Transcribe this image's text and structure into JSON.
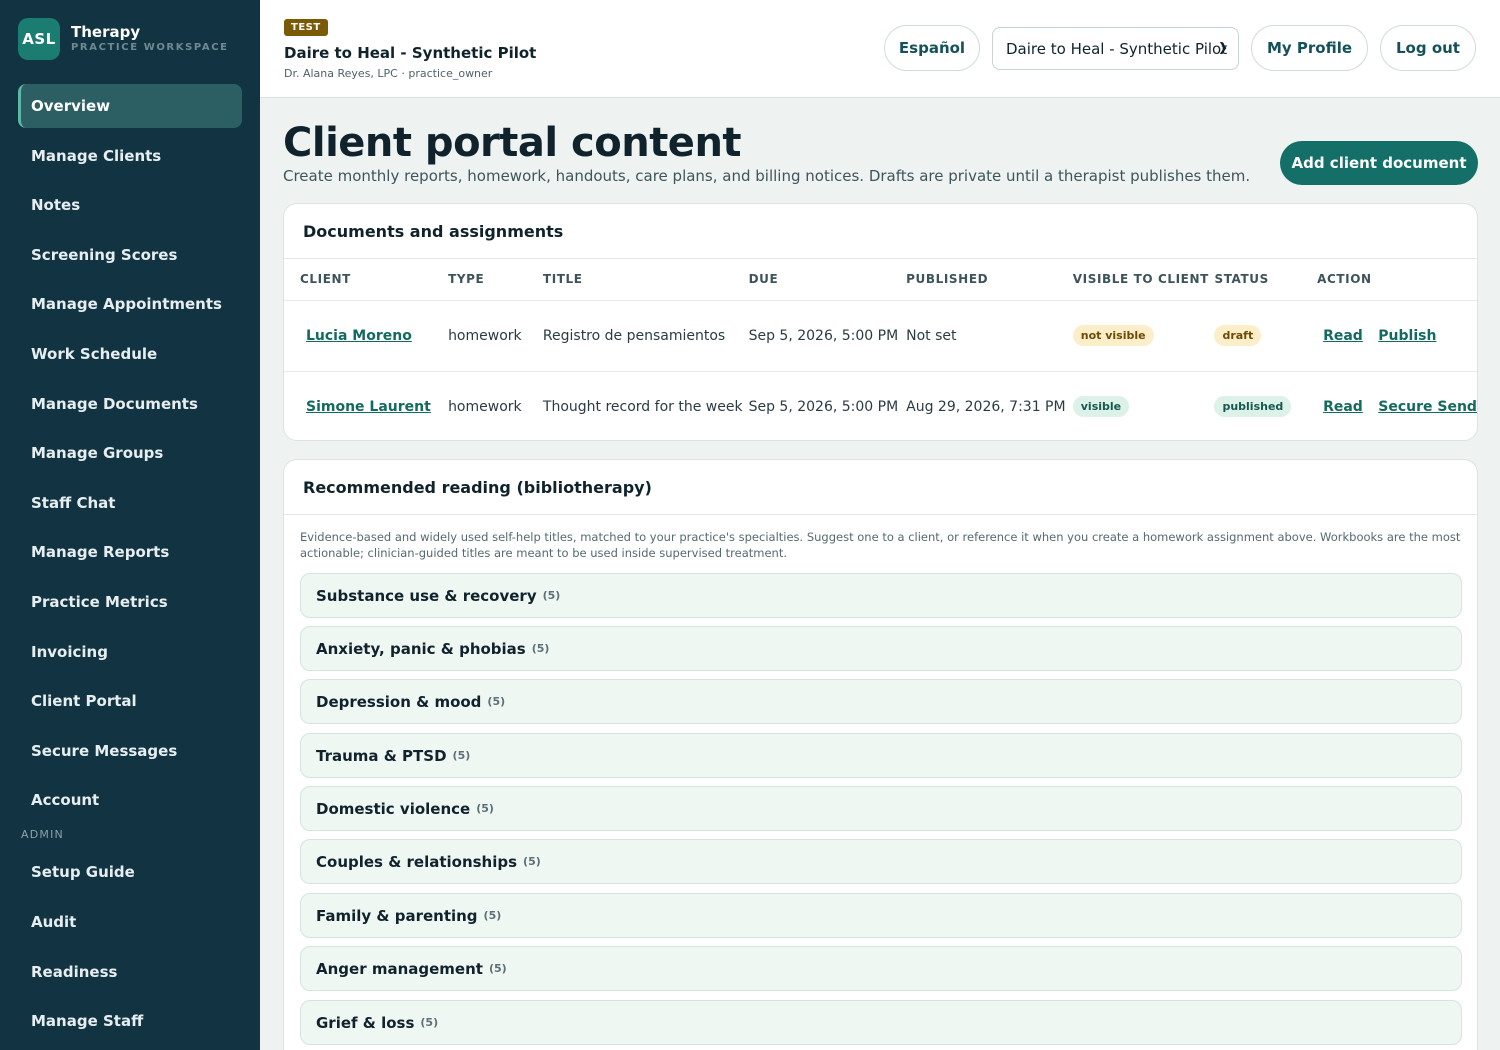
{
  "brand": {
    "logo": "ASL",
    "name": "Therapy",
    "subtitle": "PRACTICE WORKSPACE"
  },
  "sidebar": {
    "items": [
      {
        "label": "Overview",
        "active": true
      },
      {
        "label": "Manage Clients"
      },
      {
        "label": "Notes"
      },
      {
        "label": "Screening Scores"
      },
      {
        "label": "Manage Appointments"
      },
      {
        "label": "Work Schedule"
      },
      {
        "label": "Manage Documents"
      },
      {
        "label": "Manage Groups"
      },
      {
        "label": "Staff Chat"
      },
      {
        "label": "Manage Reports"
      },
      {
        "label": "Practice Metrics"
      },
      {
        "label": "Invoicing"
      },
      {
        "label": "Client Portal"
      },
      {
        "label": "Secure Messages"
      },
      {
        "label": "Account"
      }
    ],
    "admin_section": "ADMIN",
    "admin_items": [
      {
        "label": "Setup Guide"
      },
      {
        "label": "Audit"
      },
      {
        "label": "Readiness"
      },
      {
        "label": "Manage Staff"
      }
    ]
  },
  "header": {
    "badge": "TEST",
    "practice_name": "Daire to Heal - Synthetic Pilot",
    "user_line": "Dr. Alana Reyes, LPC · practice_owner",
    "language_button": "Español",
    "practice_select": "Daire to Heal - Synthetic Pilot",
    "profile_button": "My Profile",
    "logout_button": "Log out"
  },
  "main": {
    "title": "Client portal content",
    "description": "Create monthly reports, homework, handouts, care plans, and billing notices. Drafts are private until a therapist publishes them.",
    "add_button": "Add client document"
  },
  "documents": {
    "heading": "Documents and assignments",
    "columns": [
      "CLIENT",
      "TYPE",
      "TITLE",
      "DUE",
      "PUBLISHED",
      "VISIBLE TO CLIENT",
      "STATUS",
      "ACTION"
    ],
    "rows": [
      {
        "client": "Lucia Moreno",
        "type": "homework",
        "title": "Registro de pensamientos",
        "due": "Sep 5, 2026, 5:00 PM",
        "published": "Not set",
        "visible": "not visible",
        "status": "draft",
        "action_read": "Read",
        "action_2": "Publish"
      },
      {
        "client": "Simone Laurent",
        "type": "homework",
        "title": "Thought record for the week",
        "due": "Sep 5, 2026, 5:00 PM",
        "published": "Aug 29, 2026, 7:31 PM",
        "visible": "visible",
        "status": "published",
        "action_read": "Read",
        "action_2": "Secure Send"
      }
    ]
  },
  "reading": {
    "heading": "Recommended reading (bibliotherapy)",
    "intro": "Evidence-based and widely used self-help titles, matched to your practice's specialties. Suggest one to a client, or reference it when you create a homework assignment above. Workbooks are the most actionable; clinician-guided titles are meant to be used inside supervised treatment.",
    "categories": [
      {
        "name": "Substance use & recovery",
        "count": "(5)"
      },
      {
        "name": "Anxiety, panic & phobias",
        "count": "(5)"
      },
      {
        "name": "Depression & mood",
        "count": "(5)"
      },
      {
        "name": "Trauma & PTSD",
        "count": "(5)"
      },
      {
        "name": "Domestic violence",
        "count": "(5)"
      },
      {
        "name": "Couples & relationships",
        "count": "(5)"
      },
      {
        "name": "Family & parenting",
        "count": "(5)"
      },
      {
        "name": "Anger management",
        "count": "(5)"
      },
      {
        "name": "Grief & loss",
        "count": "(5)"
      }
    ]
  },
  "colors": {
    "sidebar_bg": "#123342",
    "accent": "#136f67",
    "active_nav": "#2b5f63",
    "badge_bg": "#7a5a06",
    "pill_amber": "#fbeec8",
    "pill_green": "#dcf1e8"
  }
}
